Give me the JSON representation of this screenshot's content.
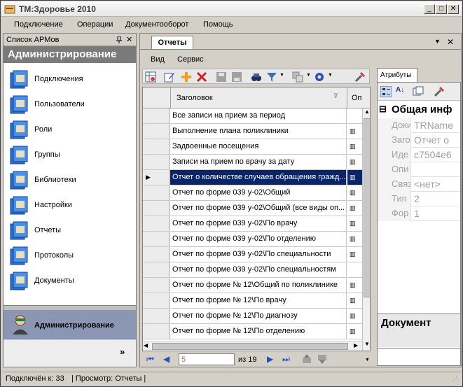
{
  "window": {
    "title": "ТМ:Здоровье 2010"
  },
  "menu": [
    "Подключение",
    "Операции",
    "Документооборот",
    "Помощь"
  ],
  "left_panel": {
    "header": "Список АРМов",
    "pin_icon": "pin-icon",
    "close": "✕",
    "banner": "Администрирование",
    "items": [
      "Подключения",
      "Пользователи",
      "Роли",
      "Группы",
      "Библиотеки",
      "Настройки",
      "Отчеты",
      "Протоколы",
      "Документы"
    ],
    "active_arm": "Администрирование",
    "expand": "»"
  },
  "document": {
    "tab": "Отчеты",
    "submenu": [
      "Вид",
      "Сервис"
    ],
    "grid": {
      "column_title": "Заголовок",
      "column_second": "Оп",
      "rows": [
        "Все записи на прием за период",
        "Выполнение плана поликлиники",
        "Задвоенные посещения",
        "Записи на прием по врачу за дату",
        "Отчет о количестве случаев обращения гражд...",
        "Отчет по форме 039 у-02\\Общий",
        "Отчет по форме 039 у-02\\Общий (все виды оп...",
        "Отчет по форме 039 у-02\\По врачу",
        "Отчет по форме 039 у-02\\По отделению",
        "Отчет по форме 039 у-02\\По специальности",
        "Отчет по форме 039 у-02\\По специальностям",
        "Отчет по форме № 12\\Общий по поликлинике",
        "Отчет по форме № 12\\По врачу",
        "Отчет по форме № 12\\По диагнозу",
        "Отчет по форме № 12\\По отделению"
      ],
      "second_col_marks": [
        "",
        "▥",
        "▥",
        "▥",
        "▥",
        "▥",
        "▥",
        "▥",
        "▥",
        "▥",
        "",
        "▥",
        "▥",
        "▥",
        "▥"
      ],
      "selected_index": 4
    },
    "navigator": {
      "position": "5",
      "of_label": "из 19"
    }
  },
  "attributes": {
    "tab": "Атрибуты",
    "category": "Общая инф",
    "props": [
      {
        "name": "Доки",
        "value": "TRName"
      },
      {
        "name": "Заго",
        "value": "Отчет о"
      },
      {
        "name": "Иде",
        "value": "c7504e6"
      },
      {
        "name": "Опи",
        "value": ""
      },
      {
        "name": "Связ",
        "value": "<нет>"
      },
      {
        "name": "Тип",
        "value": "2"
      },
      {
        "name": "Фор",
        "value": "1"
      }
    ],
    "description_title": "Документ"
  },
  "status": {
    "connected": "Подключён к: 33",
    "view": "| Просмотр: Отчеты |"
  }
}
